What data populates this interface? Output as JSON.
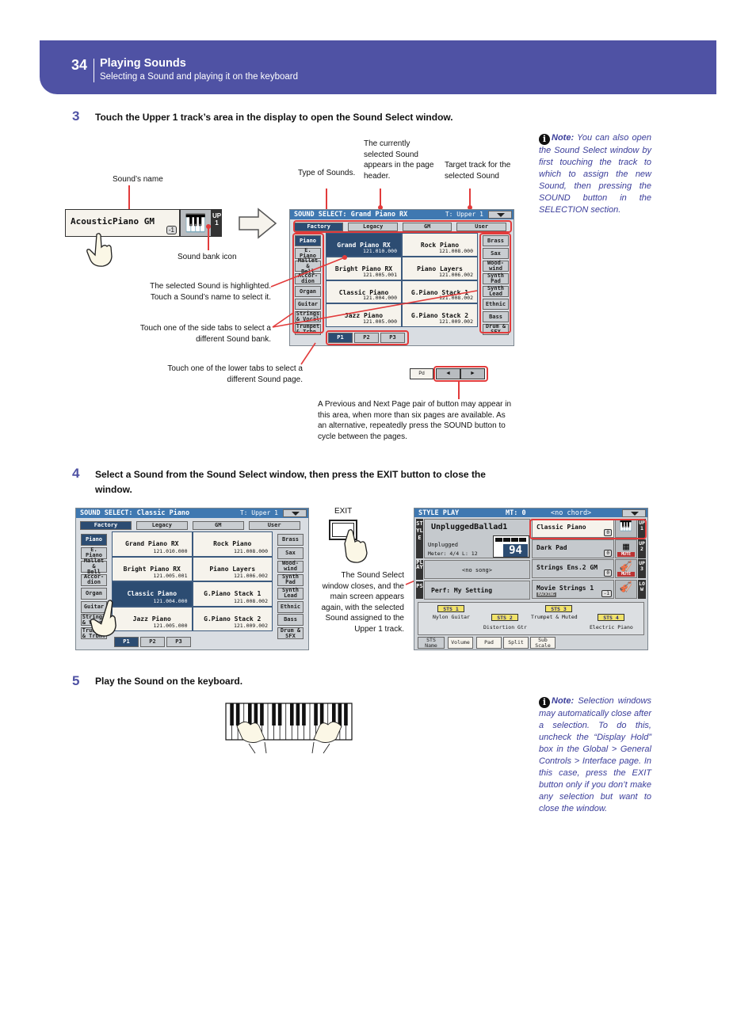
{
  "header": {
    "page_number": "34",
    "title": "Playing Sounds",
    "subtitle": "Selecting a Sound and playing it on the keyboard",
    "accent_color": "#4f52a4"
  },
  "step3": {
    "number": "3",
    "text": "Touch the Upper 1 track’s area in the display to open the Sound Select window.",
    "track_area": {
      "sound_name": "AcousticPiano GM",
      "octave_badge": "-1",
      "track_label": "UP1"
    },
    "captions": {
      "sound_name": "Sound’s name",
      "sound_bank_icon": "Sound bank icon",
      "type_of_sounds": "Type of Sounds.",
      "current_sound": "The currently selected Sound appears in the page header.",
      "target_track": "Target track for the selected Sound",
      "selected_highlight": "The selected Sound is highlighted. Touch a Sound’s name to select it.",
      "side_tabs": "Touch one of the side tabs to select a different Sound bank.",
      "lower_tabs": "Touch one of the lower tabs to select a different Sound page.",
      "prev_next": "A Previous and Next Page pair of button may appear in this area, when more than six pages are available. As an alternative, repeatedly press the SOUND button to cycle between the pages."
    },
    "pager": {
      "left_label": "Pd",
      "prev": "◄",
      "next": "►"
    },
    "note": {
      "label": "Note:",
      "text": " You can also open the Sound Select window by first touching the track to which to assign the new Sound, then pressing the SOUND button in the SELECTION section."
    }
  },
  "sound_select_1": {
    "title": "SOUND SELECT: Grand Piano RX",
    "track": "T: Upper 1",
    "top_tabs": [
      "Factory",
      "Legacy",
      "GM",
      "User"
    ],
    "left_tabs": [
      "Piano",
      "E. Piano",
      "Mallet &\nBell",
      "Accor-\ndion",
      "Organ",
      "Guitar",
      "Strings\n& Vocal",
      "Trumpet\n& Trbn."
    ],
    "right_tabs": [
      "Brass",
      "Sax",
      "Wood-\nwind",
      "Synth\nPad",
      "Synth\nLead",
      "Ethnic",
      "Bass",
      "Drum &\nSFX"
    ],
    "page_tabs": [
      "P1",
      "P2",
      "P3"
    ],
    "sounds": [
      {
        "name": "Grand Piano RX",
        "id": "121.010.000",
        "selected": true
      },
      {
        "name": "Rock Piano",
        "id": "121.008.000",
        "selected": false
      },
      {
        "name": "Bright Piano RX",
        "id": "121.005.001",
        "selected": false
      },
      {
        "name": "Piano Layers",
        "id": "121.006.002",
        "selected": false
      },
      {
        "name": "Classic Piano",
        "id": "121.004.000",
        "selected": false
      },
      {
        "name": "G.Piano Stack 1",
        "id": "121.008.002",
        "selected": false
      },
      {
        "name": "Jazz Piano",
        "id": "121.005.000",
        "selected": false
      },
      {
        "name": "G.Piano Stack 2",
        "id": "121.009.002",
        "selected": false
      }
    ]
  },
  "step4": {
    "number": "4",
    "text": "Select a Sound from the Sound Select window, then press the EXIT button to close the window.",
    "exit_label": "EXIT",
    "caption": "The Sound Select window closes, and the main screen appears again, with the selected Sound assigned to the Upper 1 track."
  },
  "sound_select_2": {
    "title": "SOUND SELECT: Classic Piano",
    "track": "T: Upper 1",
    "top_tabs": [
      "Factory",
      "Legacy",
      "GM",
      "User"
    ],
    "left_tabs": [
      "Piano",
      "E. Piano",
      "Mallet &\nBell",
      "Accor-\ndion",
      "Organ",
      "Guitar",
      "Strings\n& Vocal",
      "Trumpet\n& Trbn."
    ],
    "right_tabs": [
      "Brass",
      "Sax",
      "Wood-\nwind",
      "Synth\nPad",
      "Synth\nLead",
      "Ethnic",
      "Bass",
      "Drum &\nSFX"
    ],
    "page_tabs": [
      "P1",
      "P2",
      "P3"
    ],
    "sounds": [
      {
        "name": "Grand Piano RX",
        "id": "121.010.000",
        "selected": false
      },
      {
        "name": "Rock Piano",
        "id": "121.008.000",
        "selected": false
      },
      {
        "name": "Bright Piano RX",
        "id": "121.005.001",
        "selected": false
      },
      {
        "name": "Piano Layers",
        "id": "121.006.002",
        "selected": false
      },
      {
        "name": "Classic Piano",
        "id": "121.004.000",
        "selected": true
      },
      {
        "name": "G.Piano Stack 1",
        "id": "121.008.002",
        "selected": false
      },
      {
        "name": "Jazz Piano",
        "id": "121.005.000",
        "selected": false
      },
      {
        "name": "G.Piano Stack 2",
        "id": "121.009.002",
        "selected": false
      }
    ]
  },
  "style_play": {
    "title": "STYLE PLAY",
    "mt": "MT: 0",
    "chord": "<no chord>",
    "style_name": "UnpluggedBallad1",
    "style_bank": "Unplugged",
    "meter": "Meter: 4/4  L: 12",
    "tempo": "94",
    "song": "<no song>",
    "perf": "Perf:  My Setting",
    "side_labels": [
      "STYLE",
      "PLAY",
      "PS"
    ],
    "tracks": [
      {
        "name": "Classic Piano",
        "label": "UP1",
        "badge": "0",
        "extra": ""
      },
      {
        "name": "Dark Pad",
        "label": "UP2",
        "badge": "0",
        "extra": "MUTE"
      },
      {
        "name": "Strings Ens.2 GM",
        "label": "UP3",
        "badge": "0",
        "extra": "MUTE"
      },
      {
        "name": "Movie Strings 1",
        "label": "LOW",
        "badge": "-1",
        "extra": "BACKING"
      }
    ],
    "sts": [
      {
        "label": "STS 1",
        "sound": "Nylon Guitar"
      },
      {
        "label": "STS 2",
        "sound": "Distortion Gtr"
      },
      {
        "label": "STS 3",
        "sound": "Trumpet & Muted"
      },
      {
        "label": "STS 4",
        "sound": "Electric Piano"
      }
    ],
    "bottom_tabs": [
      "STS\nName",
      "Volume",
      "Pad",
      "Split",
      "Sub\nScale"
    ]
  },
  "step5": {
    "number": "5",
    "text": "Play the Sound on the keyboard.",
    "note": {
      "label": "Note:",
      "text": " Selection windows may automatically close after a selection. To do this, uncheck the “Display Hold” box in the Global > General Controls > Interface page. In this case, press the EXIT button only if you don’t make any selection but want to close the window."
    }
  }
}
